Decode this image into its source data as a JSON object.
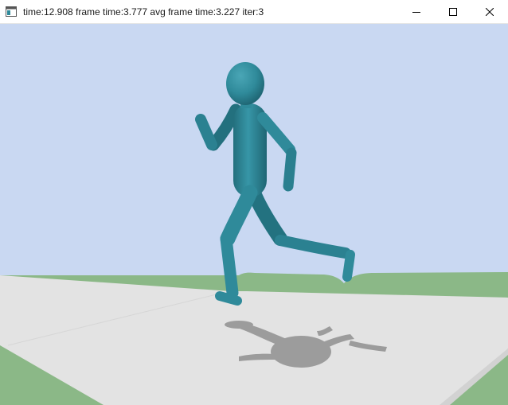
{
  "window": {
    "title": "time:12.908 frame time:3.777 avg frame time:3.227 iter:3",
    "app_icon": "window-app-icon",
    "controls": {
      "minimize_icon": "minimize-icon",
      "maximize_icon": "maximize-icon",
      "close_icon": "close-icon"
    }
  },
  "scene": {
    "sky_color": "#c9d8f2",
    "grass_color": "#8bb887",
    "ground_color": "#e3e3e3",
    "figure_color": "#2f8a9a",
    "shadow_color": "#9c9c9c"
  }
}
